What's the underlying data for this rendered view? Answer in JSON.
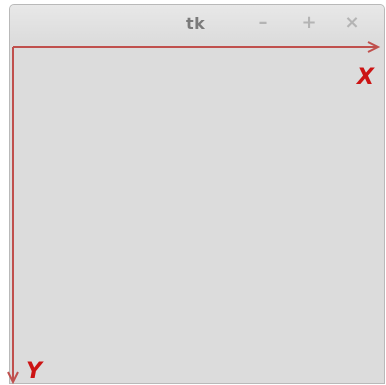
{
  "window": {
    "title": "tk",
    "controls": {
      "minimize_label": "–",
      "maximize_label": "+",
      "close_label": "×"
    }
  },
  "canvas": {
    "x_axis_label": "X",
    "y_axis_label": "Y",
    "axis_color": "#c0504d",
    "label_color": "#cc1414",
    "background_color": "#dcdcdc"
  }
}
